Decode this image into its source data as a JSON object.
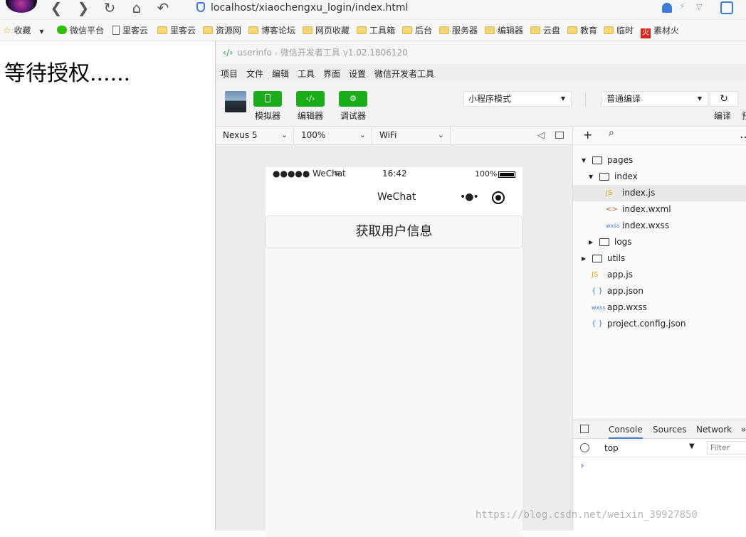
{
  "browser": {
    "url": "localhost/xiaochengxu_login/index.html",
    "nav": {
      "back": "❮",
      "forward": "❯",
      "reload": "↻",
      "home": "⌂",
      "undo": "↶"
    }
  },
  "bookmarks": [
    {
      "label": "收藏",
      "icon": "star-icon"
    },
    {
      "label": "微信平台",
      "icon": "wechat-icon"
    },
    {
      "label": "里客云",
      "icon": "page-icon"
    },
    {
      "label": "里客云",
      "icon": "folder-icon"
    },
    {
      "label": "资源网",
      "icon": "folder-icon"
    },
    {
      "label": "博客论坛",
      "icon": "folder-icon"
    },
    {
      "label": "网页收藏",
      "icon": "folder-icon"
    },
    {
      "label": "工具箱",
      "icon": "folder-icon"
    },
    {
      "label": "后台",
      "icon": "folder-icon"
    },
    {
      "label": "服务器",
      "icon": "folder-icon"
    },
    {
      "label": "编辑器",
      "icon": "folder-icon"
    },
    {
      "label": "云盘",
      "icon": "folder-icon"
    },
    {
      "label": "教育",
      "icon": "folder-icon"
    },
    {
      "label": "临时",
      "icon": "folder-icon"
    },
    {
      "label": "素材火",
      "icon": "brand-icon"
    }
  ],
  "page": {
    "text": "等待授权......"
  },
  "devtools": {
    "title": "userinfo - 微信开发者工具 v1.02.1806120",
    "menu": [
      "项目",
      "文件",
      "编辑",
      "工具",
      "界面",
      "设置",
      "微信开发者工具"
    ],
    "toolbar": {
      "simulator": "模拟器",
      "editor": "编辑器",
      "debugger": "调试器",
      "mode": "小程序模式",
      "compile_mode": "普通编译",
      "compile": "编译",
      "preview": "预"
    },
    "sim_bar": {
      "device": "Nexus 5",
      "zoom": "100%",
      "network": "WiFi"
    },
    "phone": {
      "carrier": "●●●●● WeChat",
      "time": "16:42",
      "battery": "100%",
      "nav_title": "WeChat",
      "more": "•●•",
      "auth_button": "获取用户信息"
    },
    "files": [
      {
        "name": "pages",
        "type": "folder",
        "expanded": true
      },
      {
        "name": "index",
        "type": "folder",
        "expanded": true
      },
      {
        "name": "index.js",
        "type": "js",
        "tag": "JS"
      },
      {
        "name": "index.wxml",
        "type": "wxml",
        "tag": "<>"
      },
      {
        "name": "index.wxss",
        "type": "wxss",
        "tag": "wxss"
      },
      {
        "name": "logs",
        "type": "folder",
        "expanded": false
      },
      {
        "name": "utils",
        "type": "folder",
        "expanded": false
      },
      {
        "name": "app.js",
        "type": "js",
        "tag": "JS"
      },
      {
        "name": "app.json",
        "type": "json",
        "tag": "{ }"
      },
      {
        "name": "app.wxss",
        "type": "wxss",
        "tag": "wxss"
      },
      {
        "name": "project.config.json",
        "type": "json",
        "tag": "{ }"
      }
    ],
    "console": {
      "tabs": [
        "Console",
        "Sources",
        "Network"
      ],
      "context": "top",
      "filter_placeholder": "Filter",
      "prompt": "›"
    }
  },
  "watermark": "https://blog.csdn.net/weixin_39927850",
  "colors": {
    "accent": "#1aad19",
    "link": "#3a7bd5",
    "js": "#e0a800",
    "wxml": "#e34c26",
    "json": "#3a7bd5"
  }
}
